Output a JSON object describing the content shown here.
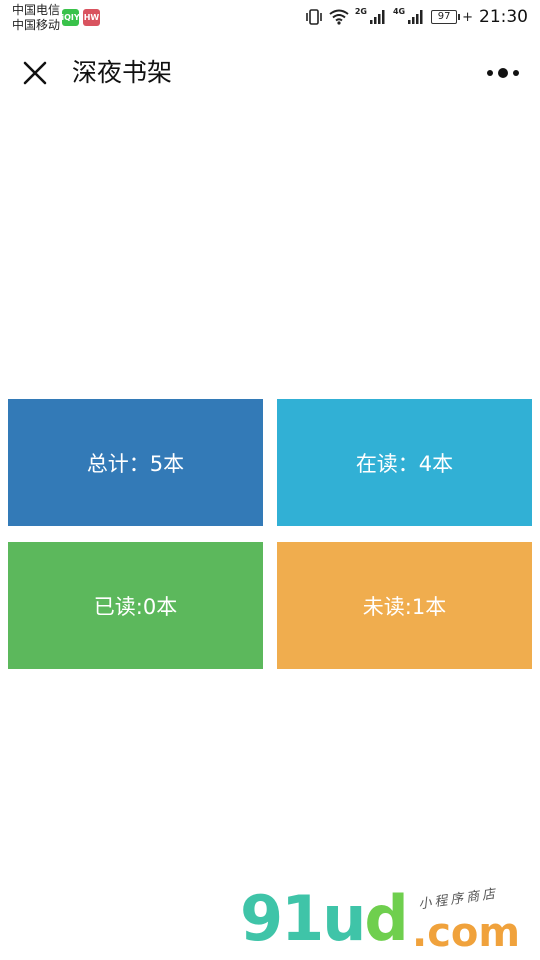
{
  "status_bar": {
    "carrier_1": "中国电信",
    "carrier_2": "中国移动",
    "app_badge_1": "iQIY",
    "app_badge_2": "HW",
    "net_2g": "2G",
    "net_4g": "4G",
    "battery": "97",
    "time": "21:30"
  },
  "nav": {
    "title": "深夜书架",
    "close_icon": "close-icon",
    "more_icon": "more-icon"
  },
  "stats": {
    "total": "总计：5本",
    "reading": "在读：4本",
    "read": "已读:0本",
    "unread": "未读:1本"
  },
  "colors": {
    "total": "#337ab7",
    "reading": "#31b0d5",
    "read": "#5cb85c",
    "unread": "#f0ad4e"
  },
  "watermark": {
    "logo_main": "91u",
    "logo_d": "d",
    "logo_com": ".com",
    "tagline": "小程序商店"
  }
}
